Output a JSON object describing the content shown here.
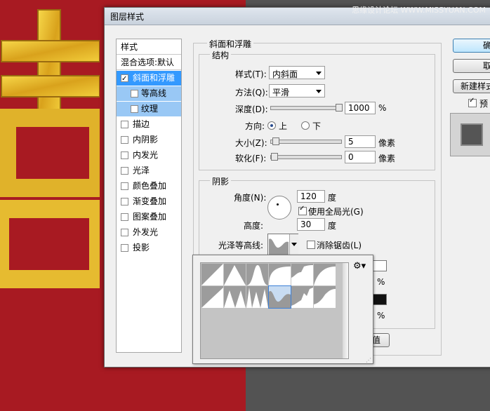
{
  "watermark": "思缘设计论坛 WWW.MISSYUAN.COM",
  "dialog": {
    "title": "图层样式",
    "styles_panel": {
      "header": "样式",
      "blend_default": "混合选项:默认",
      "items": [
        {
          "label": "斜面和浮雕",
          "checked": true,
          "selected": true
        },
        {
          "label": "等高线",
          "checked": false,
          "sub": true
        },
        {
          "label": "纹理",
          "checked": false,
          "sub": true
        },
        {
          "label": "描边",
          "checked": false
        },
        {
          "label": "内阴影",
          "checked": false
        },
        {
          "label": "内发光",
          "checked": false
        },
        {
          "label": "光泽",
          "checked": false
        },
        {
          "label": "颜色叠加",
          "checked": false
        },
        {
          "label": "渐变叠加",
          "checked": false
        },
        {
          "label": "图案叠加",
          "checked": false
        },
        {
          "label": "外发光",
          "checked": false
        },
        {
          "label": "投影",
          "checked": false
        }
      ]
    },
    "bevel": {
      "group_title": "斜面和浮雕",
      "structure_title": "结构",
      "style_label": "样式(T):",
      "style_value": "内斜面",
      "technique_label": "方法(Q):",
      "technique_value": "平滑",
      "depth_label": "深度(D):",
      "depth_value": "1000",
      "depth_unit": "%",
      "depth_slider": 1.0,
      "direction_label": "方向:",
      "dir_up": "上",
      "dir_down": "下",
      "size_label": "大小(Z):",
      "size_value": "5",
      "size_unit": "像素",
      "size_slider": 0.02,
      "soften_label": "软化(F):",
      "soften_value": "0",
      "soften_unit": "像素",
      "soften_slider": 0.0
    },
    "shading": {
      "title": "阴影",
      "angle_label": "角度(N):",
      "angle_value": "120",
      "angle_unit": "度",
      "global_light_label": "使用全局光(G)",
      "global_light_checked": true,
      "altitude_label": "高度:",
      "altitude_value": "30",
      "altitude_unit": "度",
      "gloss_label": "光泽等高线:",
      "antialias_label": "消除锯齿(L)",
      "antialias_checked": false,
      "pct1": "%",
      "pct2": "%",
      "partial_button": "值"
    },
    "buttons": {
      "ok": "确",
      "cancel": "取",
      "new_style": "新建样式",
      "preview_label": "预",
      "preview_checked": true
    }
  },
  "colors": {
    "highlight": "#3399ff",
    "sub_highlight": "#99c8f5",
    "bg_red": "#a81a22",
    "bg_dark": "#535353"
  }
}
